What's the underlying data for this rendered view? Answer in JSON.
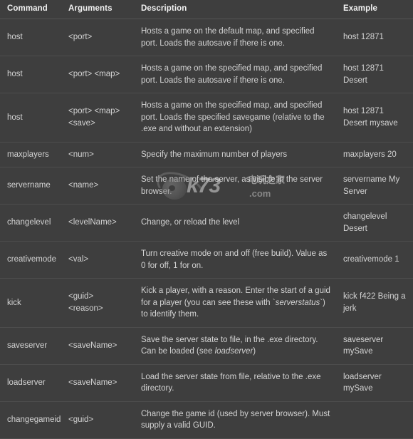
{
  "table": {
    "columns": [
      {
        "key": "command",
        "label": "Command"
      },
      {
        "key": "arguments",
        "label": "Arguments"
      },
      {
        "key": "description",
        "label": "Description"
      },
      {
        "key": "example",
        "label": "Example"
      }
    ],
    "rows": [
      {
        "command": "host",
        "arguments": "<port>",
        "description": "Hosts a game on the default map, and specified port. Loads the autosave if there is one.",
        "example": "host 12871"
      },
      {
        "command": "host",
        "arguments": "<port> <map>",
        "description": "Hosts a game on the specified map, and specified port. Loads the autosave if there is one.",
        "example": "host 12871 Desert"
      },
      {
        "command": "host",
        "arguments": "<port> <map> <save>",
        "description": "Hosts a game on the specified map, and specified port. Loads the specified savegame (relative to the .exe and without an extension)",
        "example": "host 12871 Desert mysave"
      },
      {
        "command": "maxplayers",
        "arguments": "<num>",
        "description": "Specify the maximum number of players",
        "example": "maxplayers 20"
      },
      {
        "command": "servername",
        "arguments": "<name>",
        "description": "Set the name of the server, as visible in the server browser.",
        "example": "servername My Server"
      },
      {
        "command": "changelevel",
        "arguments": "<levelName>",
        "description": "Change, or reload the level",
        "example": "changelevel Desert"
      },
      {
        "command": "creativemode",
        "arguments": "<val>",
        "description": "Turn creative mode on and off (free build). Value as 0 for off, 1 for on.",
        "example": "creativemode 1"
      },
      {
        "command": "kick",
        "arguments": "<guid> <reason>",
        "description_parts": [
          {
            "text": "Kick a player, with a reason. Enter the start of a guid for a player (you can see these with `",
            "style": "normal"
          },
          {
            "text": "serverstatus",
            "style": "italic"
          },
          {
            "text": "`) to identify them.",
            "style": "normal"
          }
        ],
        "description": "Kick a player, with a reason. Enter the start of a guid for a player (you can see these with `serverstatus`) to identify them.",
        "example": "kick f422 Being a jerk"
      },
      {
        "command": "saveserver",
        "arguments": "<saveName>",
        "description_parts": [
          {
            "text": "Save the server state to file, in the .exe directory. Can be loaded (see ",
            "style": "normal"
          },
          {
            "text": "loadserver",
            "style": "italic"
          },
          {
            "text": ")",
            "style": "normal"
          }
        ],
        "description": "Save the server state to file, in the .exe directory. Can be loaded (see loadserver)",
        "example": "saveserver mySave"
      },
      {
        "command": "loadserver",
        "arguments": "<saveName>",
        "description": "Load the server state from file, relative to the .exe directory.",
        "example": "loadserver mySave"
      },
      {
        "command": "changegameid",
        "arguments": "<guid>",
        "description": "Change the game id (used by server browser). Must supply a valid GUID.",
        "example": ""
      }
    ]
  },
  "watermark": {
    "brand": "k73",
    "chinese": "电玩之家",
    "domain": ".com"
  },
  "colors": {
    "background": "#3e3e3e",
    "text": "#d3d3d3",
    "header_text": "#f1f1f1",
    "divider": "#4d4d4d"
  }
}
